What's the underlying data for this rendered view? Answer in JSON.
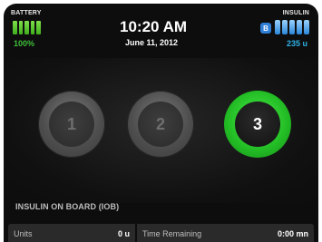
{
  "status": {
    "battery_label": "BATTERY",
    "battery_percent": "100%",
    "insulin_label": "INSULIN",
    "insulin_badge": "B",
    "insulin_units": "235 u"
  },
  "clock": {
    "time": "10:20 AM",
    "date": "June 11, 2012"
  },
  "profiles": [
    {
      "label": "1",
      "active": false
    },
    {
      "label": "2",
      "active": false
    },
    {
      "label": "3",
      "active": true
    }
  ],
  "iob": {
    "title": "INSULIN ON BOARD (IOB)",
    "units_label": "Units",
    "units_value": "0 u",
    "time_label": "Time Remaining",
    "time_value": "0:00 mn"
  },
  "colors": {
    "battery": "#3fbf3a",
    "insulin": "#2fb1e8",
    "active_ring": "#22bb24",
    "background": "#0d0d0d"
  }
}
